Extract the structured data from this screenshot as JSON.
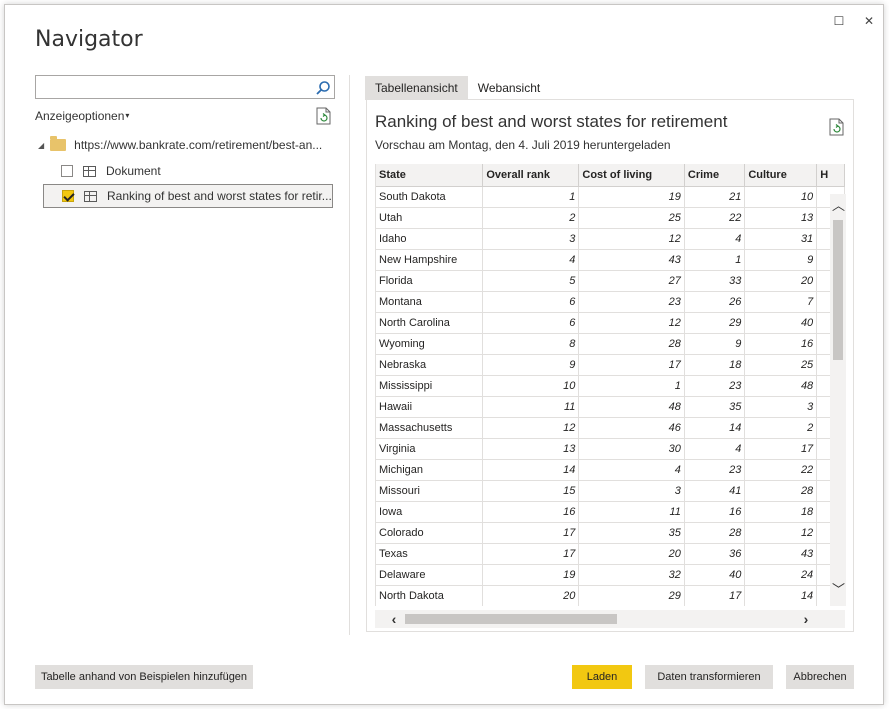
{
  "window": {
    "title": "Navigator",
    "maximize_glyph": "☐",
    "close_glyph": "✕"
  },
  "left": {
    "search": {
      "value": "",
      "placeholder": ""
    },
    "display_options_label": "Anzeigeoptionen",
    "tree": {
      "root_label": "https://www.bankrate.com/retirement/best-an...",
      "items": [
        {
          "label": "Dokument",
          "checked": false,
          "selected": false
        },
        {
          "label": "Ranking of best and worst states for retir...",
          "checked": true,
          "selected": true
        }
      ]
    }
  },
  "tabs": [
    {
      "label": "Tabellenansicht",
      "active": true
    },
    {
      "label": "Webansicht",
      "active": false
    }
  ],
  "preview": {
    "title": "Ranking of best and worst states for retirement",
    "subtitle": "Vorschau am Montag, den 4. Juli 2019 heruntergeladen",
    "columns": [
      "State",
      "Overall rank",
      "Cost of living",
      "Crime",
      "Culture",
      "H"
    ],
    "rows": [
      [
        "South Dakota",
        "1",
        "19",
        "21",
        "10"
      ],
      [
        "Utah",
        "2",
        "25",
        "22",
        "13"
      ],
      [
        "Idaho",
        "3",
        "12",
        "4",
        "31"
      ],
      [
        "New Hampshire",
        "4",
        "43",
        "1",
        "9"
      ],
      [
        "Florida",
        "5",
        "27",
        "33",
        "20"
      ],
      [
        "Montana",
        "6",
        "23",
        "26",
        "7"
      ],
      [
        "North Carolina",
        "6",
        "12",
        "29",
        "40"
      ],
      [
        "Wyoming",
        "8",
        "28",
        "9",
        "16"
      ],
      [
        "Nebraska",
        "9",
        "17",
        "18",
        "25"
      ],
      [
        "Mississippi",
        "10",
        "1",
        "23",
        "48"
      ],
      [
        "Hawaii",
        "11",
        "48",
        "35",
        "3"
      ],
      [
        "Massachusetts",
        "12",
        "46",
        "14",
        "2"
      ],
      [
        "Virginia",
        "13",
        "30",
        "4",
        "17"
      ],
      [
        "Michigan",
        "14",
        "4",
        "23",
        "22"
      ],
      [
        "Missouri",
        "15",
        "3",
        "41",
        "28"
      ],
      [
        "Iowa",
        "16",
        "11",
        "16",
        "18"
      ],
      [
        "Colorado",
        "17",
        "35",
        "28",
        "12"
      ],
      [
        "Texas",
        "17",
        "20",
        "36",
        "43"
      ],
      [
        "Delaware",
        "19",
        "32",
        "40",
        "24"
      ],
      [
        "North Dakota",
        "20",
        "29",
        "17",
        "14"
      ]
    ]
  },
  "buttons": {
    "add_table": "Tabelle anhand von Beispielen hinzufügen",
    "load": "Laden",
    "transform": "Daten transformieren",
    "cancel": "Abbrechen"
  },
  "colors": {
    "accent_yellow": "#f2c811",
    "folder": "#e8c36a",
    "button_gray": "#e1dfdd"
  },
  "icons": {
    "search": "search-icon",
    "refresh": "refresh-icon",
    "folder": "folder-icon",
    "table": "table-icon"
  }
}
